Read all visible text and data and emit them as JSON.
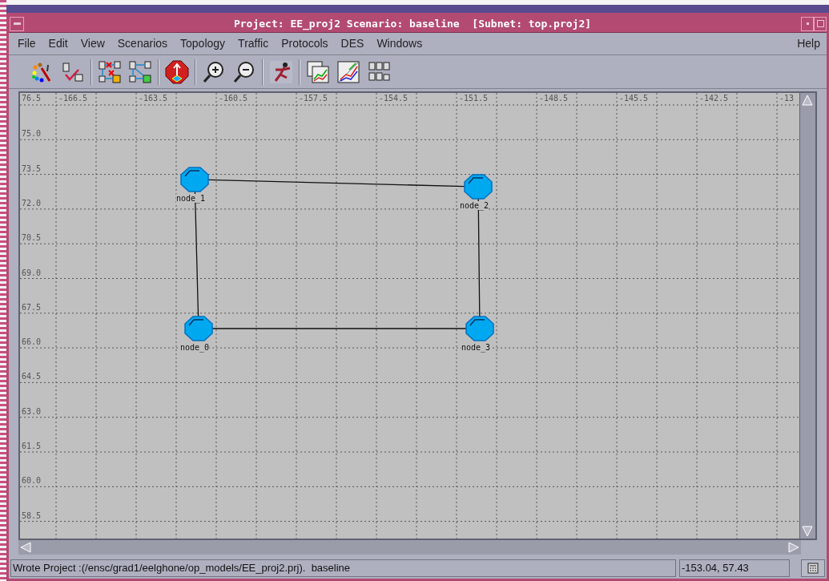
{
  "window": {
    "title": "Project: EE_proj2 Scenario: baseline  [Subnet: top.proj2]"
  },
  "menu": [
    {
      "label": "File"
    },
    {
      "label": "Edit"
    },
    {
      "label": "View"
    },
    {
      "label": "Scenarios"
    },
    {
      "label": "Topology"
    },
    {
      "label": "Traffic"
    },
    {
      "label": "Protocols"
    },
    {
      "label": "DES"
    },
    {
      "label": "Windows"
    }
  ],
  "help_menu": {
    "label": "Help"
  },
  "toolbar": [
    {
      "kind": "palette"
    },
    {
      "kind": "check"
    },
    {
      "kind": "sep"
    },
    {
      "kind": "fail"
    },
    {
      "kind": "recover"
    },
    {
      "kind": "sep"
    },
    {
      "kind": "badge"
    },
    {
      "kind": "sep"
    },
    {
      "kind": "zoomin"
    },
    {
      "kind": "zoomout"
    },
    {
      "kind": "sep"
    },
    {
      "kind": "runner"
    },
    {
      "kind": "sep"
    },
    {
      "kind": "results"
    },
    {
      "kind": "graph"
    },
    {
      "kind": "grid"
    }
  ],
  "canvas": {
    "x_labels": [
      "-166.5",
      "-163.5",
      "-160.5",
      "-157.5",
      "-154.5",
      "-151.5",
      "-148.5",
      "-145.5",
      "-142.5",
      "-13"
    ],
    "y_labels": [
      "76.5",
      "75.0",
      "73.5",
      "72.0",
      "70.5",
      "69.0",
      "67.5",
      "66.0",
      "64.5",
      "63.0",
      "61.5",
      "60.0",
      "58.5"
    ],
    "nodes": [
      {
        "label": "node_1"
      },
      {
        "label": "node_2"
      },
      {
        "label": "node_0"
      },
      {
        "label": "node_3"
      }
    ]
  },
  "status_bar": {
    "message": "Wrote Project :(/ensc/grad1/eelghone/op_models/EE_proj2.prj).  baseline",
    "coordinates": "-153.04, 57.43"
  }
}
